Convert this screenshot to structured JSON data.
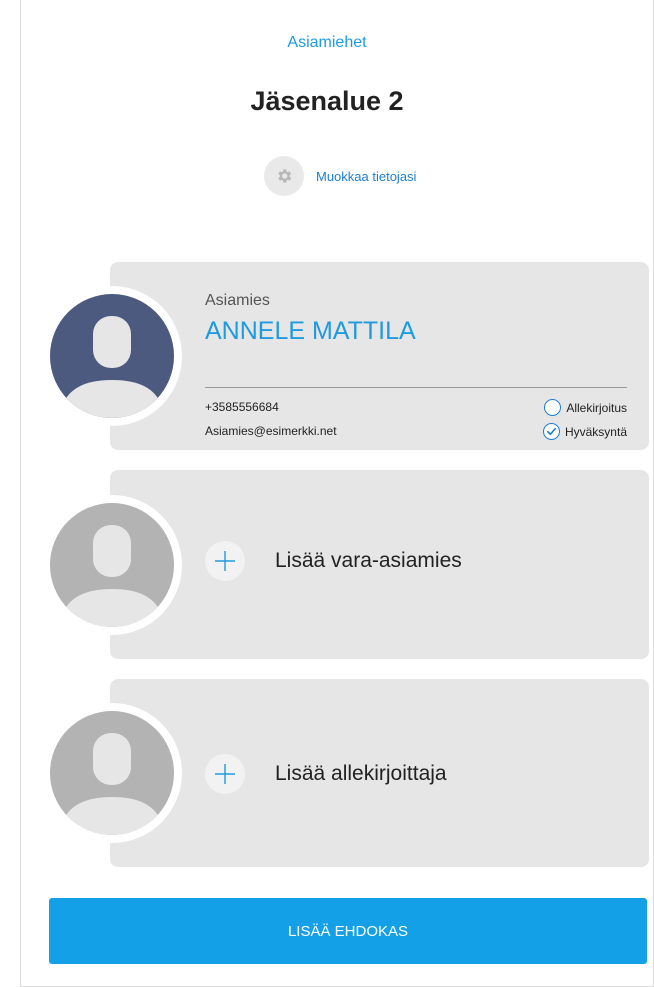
{
  "header": {
    "breadcrumb_link": "Asiamiehet",
    "title": "Jäsenalue 2",
    "edit_label": "Muokkaa tietojasi",
    "edit_icon": "gear-icon"
  },
  "agent_card": {
    "role": "Asiamies",
    "name": "ANNELE MATTILA",
    "phone": "+3585556684",
    "email": "Asiamies@esimerkki.net",
    "checks": [
      {
        "label": "Allekirjoitus",
        "checked": false
      },
      {
        "label": "Hyväksyntä",
        "checked": true
      }
    ],
    "avatar_color": "#4d5a80"
  },
  "add_cards": [
    {
      "label": "Lisää vara-asiamies",
      "icon": "plus-icon"
    },
    {
      "label": "Lisää allekirjoittaja",
      "icon": "plus-icon"
    }
  ],
  "placeholder_avatar_color": "#b3b3b3",
  "primary_button": {
    "label": "LISÄÄ EHDOKAS"
  },
  "colors": {
    "accent": "#1e9be0",
    "button": "#14a0e6",
    "card_bg": "#e6e6e6"
  }
}
